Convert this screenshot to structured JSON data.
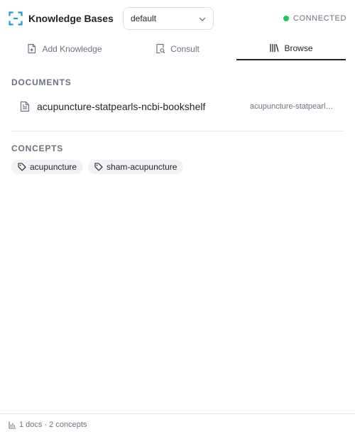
{
  "app": {
    "title": "Knowledge Bases",
    "logo_icon": "bracket-frame-icon",
    "accent_color": "#1a9ec9"
  },
  "kb_select": {
    "value": "default",
    "icon": "chevron-down-icon"
  },
  "status": {
    "label": "CONNECTED",
    "color": "#22c55e"
  },
  "tabs": [
    {
      "label": "Add Knowledge",
      "icon": "file-plus-icon",
      "active": false
    },
    {
      "label": "Consult",
      "icon": "search-doc-icon",
      "active": false
    },
    {
      "label": "Browse",
      "icon": "library-icon",
      "active": true
    }
  ],
  "documents": {
    "heading": "DOCUMENTS",
    "items": [
      {
        "name": "acupuncture-statpearls-ncbi-bookshelf",
        "source": "acupuncture-statpearls-ncbi-bookshelf",
        "icon": "document-icon"
      }
    ]
  },
  "concepts": {
    "heading": "CONCEPTS",
    "items": [
      {
        "label": "acupuncture",
        "icon": "tag-icon"
      },
      {
        "label": "sham-acupuncture",
        "icon": "tag-icon"
      }
    ]
  },
  "footer": {
    "summary": "1 docs · 2 concepts",
    "icon": "bar-chart-icon"
  }
}
